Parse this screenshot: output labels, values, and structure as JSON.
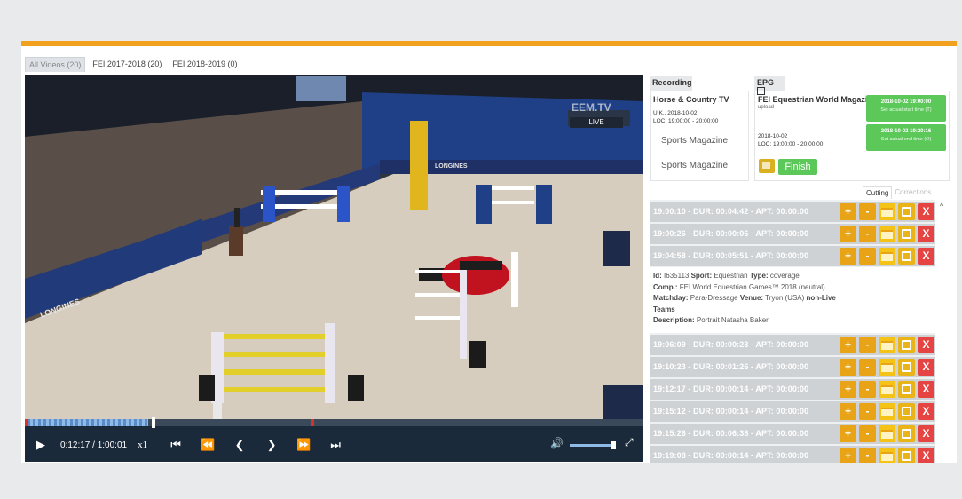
{
  "tabs": [
    {
      "label": "All Videos (20)"
    },
    {
      "label": "FEI 2017-2018 (20)"
    },
    {
      "label": "FEI 2018-2019 (0)"
    }
  ],
  "video": {
    "live_badge": "LIVE",
    "overlay_logo": "EEM.TV",
    "board_brand": "LONGINES",
    "progress": 0.205,
    "buffered": 0.2,
    "time": "0:12:17 / 1:00:01",
    "speed": "x1",
    "volume": 0.95
  },
  "recording": {
    "tab_label": "Recording",
    "station": "Horse & Country TV",
    "meta_line1": "U.K., 2018-10-02",
    "meta_line2": "LOC: 19:00:00 - 20:00:00",
    "program1": "Sports Magazine",
    "program2": "Sports Magazine"
  },
  "epg": {
    "tab_label": "EPG",
    "title": "FEI Equestrian World Magazine",
    "upload": "upload",
    "meta_line1": "2018-10-02",
    "meta_line2": "LOC: 19:00:00 - 20:00:00",
    "start_time": "2018-10-02 19:00:00",
    "start_label": "Set actual start time (T)",
    "end_time": "2018-10-02 19:20:16",
    "end_label": "Set actual end time (O)",
    "finish_label": "Finish"
  },
  "subtabs": [
    {
      "label": "Cutting"
    },
    {
      "label": "Corrections"
    }
  ],
  "cuts_top": [
    {
      "text": "19:00:10 - DUR: 00:04:42 - APT: 00:00:00"
    },
    {
      "text": "19:00:26 - DUR: 00:00:06 - APT: 00:00:00"
    },
    {
      "text": "19:04:58 - DUR: 00:05:51 - APT: 00:00:00"
    }
  ],
  "details": {
    "id_label": "Id:",
    "id": "I635113",
    "sport_label": "Sport:",
    "sport": "Equestrian",
    "type_label": "Type:",
    "type": "coverage",
    "comp_label": "Comp.:",
    "comp": "FEI World Equestrian Games™ 2018 (neutral)",
    "matchday_label": "Matchday:",
    "matchday": "Para-Dressage",
    "venue_label": "Venue:",
    "venue": "Tryon (USA)",
    "nonlive": "non-Live",
    "teams_label": "Teams",
    "desc_label": "Description:",
    "desc": "Portrait Natasha Baker"
  },
  "cuts_bottom": [
    {
      "text": "19:06:09 - DUR: 00:00:23 - APT: 00:00:00"
    },
    {
      "text": "19:10:23 - DUR: 00:01:26 - APT: 00:00:00"
    },
    {
      "text": "19:12:17 - DUR: 00:00:14 - APT: 00:00:00"
    },
    {
      "text": "19:15:12 - DUR: 00:00:14 - APT: 00:00:00"
    },
    {
      "text": "19:15:26 - DUR: 00:06:38 - APT: 00:00:00"
    },
    {
      "text": "19:19:08 - DUR: 00:00:14 - APT: 00:00:00"
    }
  ],
  "icons": {
    "play": "▶",
    "first": "⏮",
    "rewind": "⏪",
    "prev": "❮",
    "next": "❯",
    "forward": "⏩",
    "last": "⏭",
    "volume": "🔊",
    "fullscreen": "⤢",
    "add": "+",
    "remove": "-",
    "delete": "X",
    "scroll_up": "^"
  },
  "colors": {
    "accent": "#f2a11f",
    "green": "#5cc85a",
    "delete": "#e64343",
    "add": "#e8a317",
    "player_bar": "#1b2a3a"
  }
}
